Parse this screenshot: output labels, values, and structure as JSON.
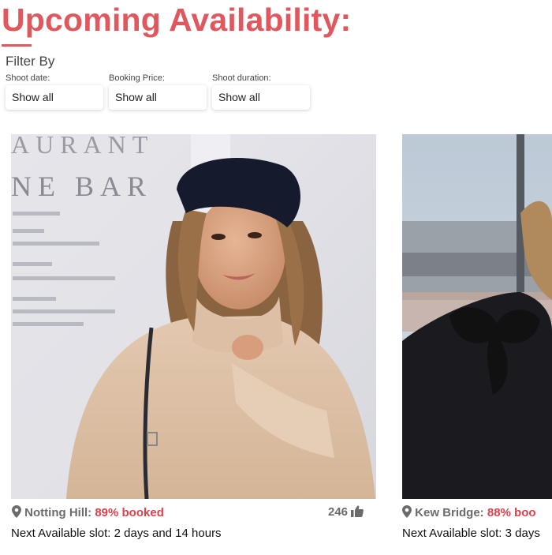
{
  "page": {
    "title": "Upcoming Availability:",
    "accent_color": "#e0585e"
  },
  "filters": {
    "heading": "Filter By",
    "items": [
      {
        "label": "Shoot date:",
        "value": "Show all"
      },
      {
        "label": "Booking Price:",
        "value": "Show all"
      },
      {
        "label": "Shoot duration:",
        "value": "Show all"
      }
    ]
  },
  "cards": [
    {
      "location": "Notting Hill:",
      "booked": "89% booked",
      "likes": "246",
      "like_icon": "thumbs-up-icon",
      "location_icon": "map-pin-icon",
      "next_slot": "Next Available slot: 2 days and 14 hours",
      "restaurant_text_1": "AURANT",
      "restaurant_text_2": "NE BAR"
    },
    {
      "location": "Kew Bridge:",
      "booked": "88% boo",
      "location_icon": "map-pin-icon",
      "next_slot": "Next Available slot: 3 days"
    }
  ]
}
